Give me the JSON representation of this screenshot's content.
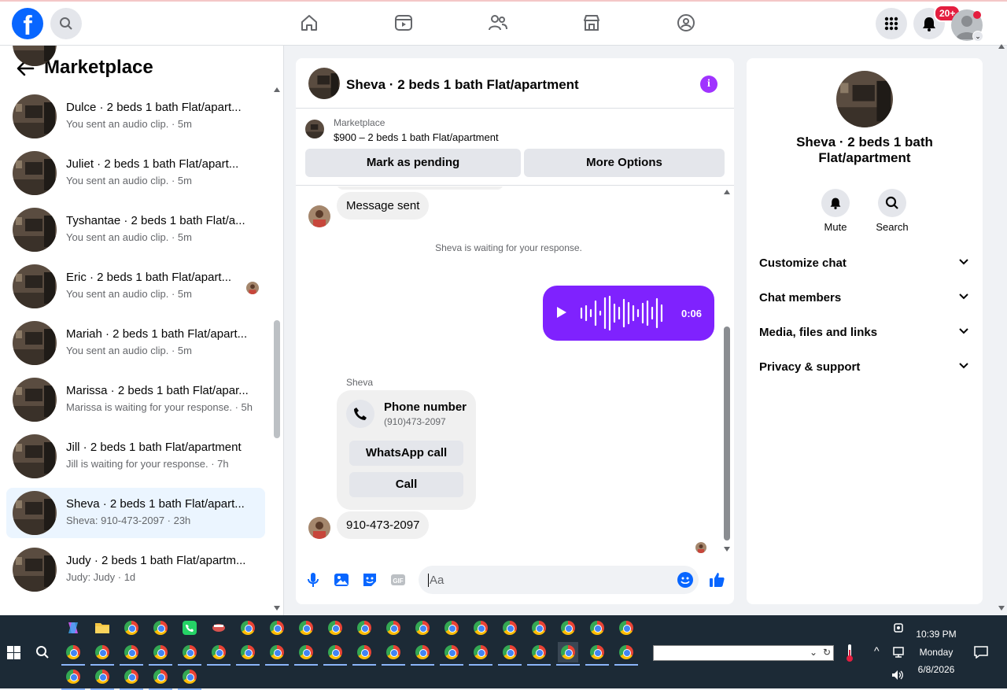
{
  "topbar": {
    "logo_letter": "f",
    "notification_count": "20+"
  },
  "sidebar": {
    "title": "Marketplace",
    "conversations": [
      {
        "name": "Dulce · 2 beds 1 bath Flat/apart...",
        "preview": "You sent an audio clip. · 5m"
      },
      {
        "name": "Juliet · 2 beds 1 bath Flat/apart...",
        "preview": "You sent an audio clip. · 5m"
      },
      {
        "name": "Tyshantae · 2 beds 1 bath Flat/a...",
        "preview": "You sent an audio clip. · 5m"
      },
      {
        "name": "Eric · 2 beds 1 bath Flat/apart...",
        "preview": "You sent an audio clip. · 5m"
      },
      {
        "name": "Mariah · 2 beds 1 bath Flat/apart...",
        "preview": "You sent an audio clip. · 5m"
      },
      {
        "name": "Marissa · 2 beds 1 bath Flat/apar...",
        "preview": "Marissa is waiting for your response. · 5h"
      },
      {
        "name": "Jill · 2 beds 1 bath Flat/apartment",
        "preview": "Jill is waiting for your response. · 7h"
      },
      {
        "name": "Sheva · 2 beds 1 bath Flat/apart...",
        "preview": "Sheva: 910-473-2097 · 23h"
      },
      {
        "name": "Judy · 2 beds 1 bath Flat/apartm...",
        "preview": "Judy: Judy · 1d"
      }
    ]
  },
  "chat": {
    "title": "Sheva · 2 beds 1 bath Flat/apartment",
    "info_glyph": "i",
    "marketplace_label": "Marketplace",
    "listing": "$900 – 2 beds 1 bath Flat/apartment",
    "mark_pending": "Mark as pending",
    "more_options": "More Options",
    "msg_sent": "Message sent",
    "waiting_text": "Sheva is waiting for your response.",
    "audio_duration": "0:06",
    "sender_name": "Sheva",
    "phone_label": "Phone number",
    "phone_number": "(910)473-2097",
    "whatsapp_call": "WhatsApp call",
    "call": "Call",
    "last_message": "910-473-2097",
    "composer_placeholder": "Aa"
  },
  "details": {
    "title": "Sheva · 2 beds 1 bath Flat/apartment",
    "mute": "Mute",
    "search": "Search",
    "sections": [
      "Customize chat",
      "Chat members",
      "Media, files and links",
      "Privacy & support"
    ]
  },
  "taskbar": {
    "time": "10:39 PM",
    "day": "Monday",
    "date": "6/8/2026"
  },
  "colors": {
    "brand_blue": "#0866ff",
    "messenger_purple": "#7f22fe",
    "notification_red": "#e41e3f",
    "active_row": "#ebf5ff"
  }
}
